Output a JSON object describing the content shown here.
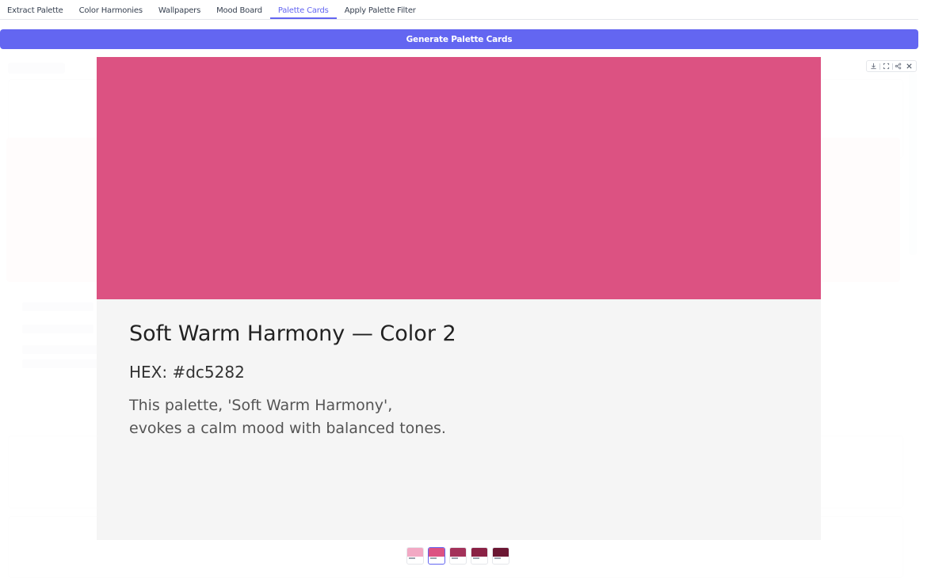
{
  "tabs": [
    {
      "label": "Extract Palette",
      "active": false
    },
    {
      "label": "Color Harmonies",
      "active": false
    },
    {
      "label": "Wallpapers",
      "active": false
    },
    {
      "label": "Mood Board",
      "active": false
    },
    {
      "label": "Palette Cards",
      "active": true
    },
    {
      "label": "Apply Palette Filter",
      "active": false
    }
  ],
  "generate_button": {
    "label": "Generate Palette Cards"
  },
  "toolbar": {
    "icons": [
      "download-icon",
      "fullscreen-icon",
      "share-icon",
      "close-icon"
    ]
  },
  "card": {
    "color": "#dc5282",
    "title": "Soft Warm Harmony — Color 2",
    "hex_label": "HEX: #dc5282",
    "description_line1": "This palette, 'Soft Warm Harmony',",
    "description_line2": "evokes a calm mood with balanced tones."
  },
  "thumbnails": [
    {
      "color": "#f2a9c4",
      "active": false
    },
    {
      "color": "#dc5282",
      "active": true
    },
    {
      "color": "#a3325a",
      "active": false
    },
    {
      "color": "#8a2145",
      "active": false
    },
    {
      "color": "#6b1733",
      "active": false
    }
  ],
  "colors": {
    "accent": "#6366f1",
    "card_background": "#f5f5f5"
  }
}
